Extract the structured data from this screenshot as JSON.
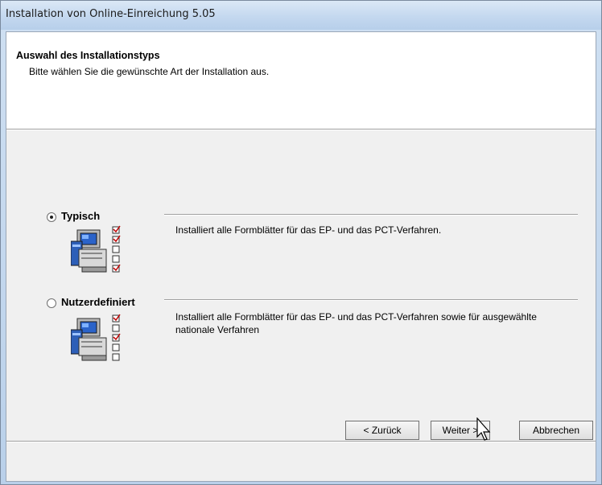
{
  "window": {
    "title": "Installation von Online-Einreichung 5.05"
  },
  "header": {
    "title": "Auswahl des Installationstyps",
    "subtitle": "Bitte wählen Sie die gewünschte Art der Installation aus."
  },
  "options": [
    {
      "label": "Typisch",
      "selected": true,
      "description": "Installiert alle Formblätter für das EP- und das PCT-Verfahren.",
      "icon": "typical-install-icon"
    },
    {
      "label": "Nutzerdefiniert",
      "selected": false,
      "description": "Installiert alle Formblätter für das EP- und das PCT-Verfahren sowie für ausgewählte nationale Verfahren",
      "icon": "custom-install-icon"
    }
  ],
  "buttons": {
    "back": "< Zurück",
    "next": "Weiter >",
    "cancel": "Abbrechen"
  },
  "cursor": "mouse-pointer-icon"
}
